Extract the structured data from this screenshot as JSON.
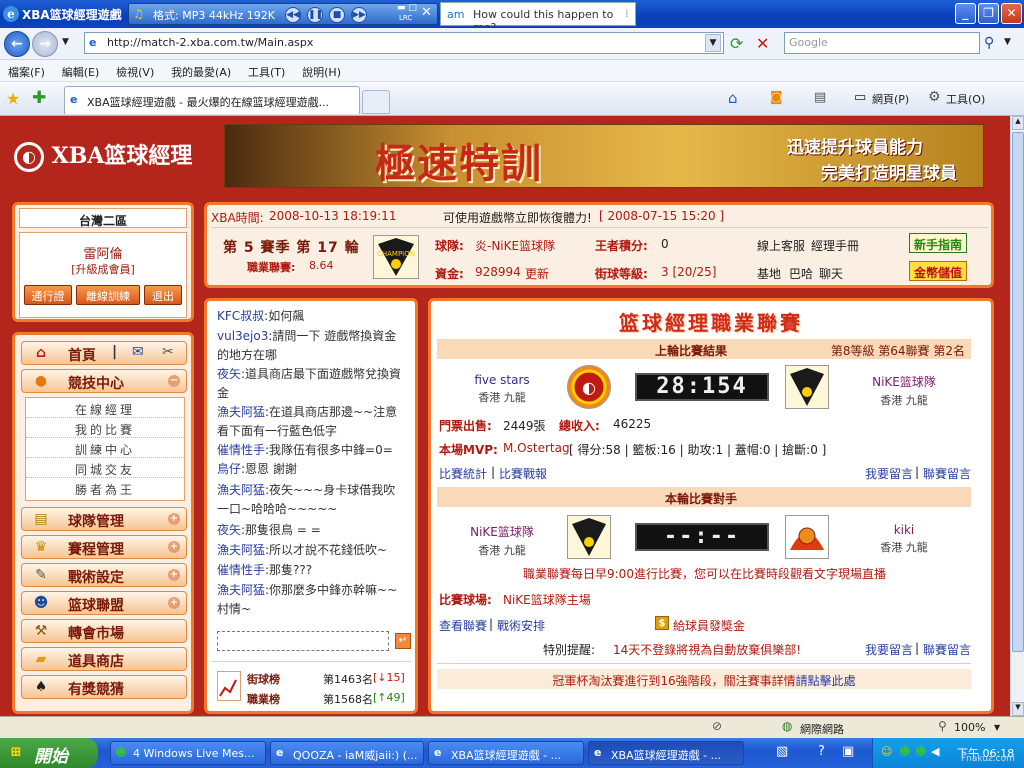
{
  "window": {
    "title": "XBA篮球經理遊戲",
    "media_format": "格式: MP3 44kHz 192K",
    "media_tag": "LRC",
    "tooltip_app": "am",
    "tooltip_song": "How could this happen to me?"
  },
  "browser": {
    "url": "http://match-2.xba.com.tw/Main.aspx",
    "search_placeholder": "Google",
    "menu": [
      "檔案(F)",
      "編輯(E)",
      "檢視(V)",
      "我的最愛(A)",
      "工具(T)",
      "說明(H)"
    ],
    "tab_title": "XBA篮球經理遊戲 - 最火爆的在線篮球經理遊戲...",
    "toolbar_page": "網頁(P)",
    "toolbar_tools": "工具(O)"
  },
  "site": {
    "logo": "XBA篮球經理",
    "banner_main": "極速特訓",
    "banner_line1": "迅速提升球員能力",
    "banner_line2": "完美打造明星球員"
  },
  "user": {
    "region": "台灣二區",
    "name": "雷阿倫",
    "grade": "[升級成會員]",
    "buttons": [
      "通行證",
      "離線訓練",
      "退出"
    ]
  },
  "menu": {
    "home": "首頁",
    "competition": "競技中心",
    "sub": [
      "在線經理",
      "我的比賽",
      "訓練中心",
      "同城交友",
      "勝者為王"
    ],
    "items": [
      "球隊管理",
      "賽程管理",
      "戰術設定",
      "篮球聯盟",
      "轉會市場",
      "道具商店",
      "有獎競猜"
    ]
  },
  "info": {
    "time_label": "XBA時間:",
    "time": "2008-10-13 18:19:11",
    "notice": "可使用遊戲幣立即恢復體力!",
    "notice_date": "[ 2008-07-15 15:20 ]",
    "season": "第 5 賽季 第 17 輪",
    "pro_label": "職業聯賽:",
    "pro_value": "8.64",
    "team_label": "球隊:",
    "team": "炎-NiKE篮球隊",
    "king_label": "王者積分:",
    "king": "0",
    "service": "線上客服",
    "manual": "經理手冊",
    "money_label": "資金:",
    "money": "928994",
    "update": "更新",
    "street_label": "街球等級:",
    "street": "3 [20/25]",
    "base": "基地",
    "baha": "巴哈",
    "chat_link": "聊天",
    "guide_btn": "新手指南",
    "coin_btn": "金幣儲值"
  },
  "chat": {
    "lines": [
      {
        "name": "KFC叔叔",
        "msg": ":如何飆"
      },
      {
        "name": "vul3ejo3",
        "msg": ":請問一下 遊戲幣換資金的地方在哪"
      },
      {
        "name": "夜矢",
        "msg": ":道具商店最下面遊戲幣兌換資金"
      },
      {
        "name": "漁夫阿猛",
        "msg": ":在道具商店那邊~~注意看下面有一行藍色低字"
      },
      {
        "name": "催情性手",
        "msg": ":我隊伍有很多中鋒=0="
      },
      {
        "name": "鳥仔",
        "msg": ":恩恩 謝謝"
      },
      {
        "name": "漁夫阿猛",
        "msg": ":夜矢~~~身卡球借我吹一口~哈哈哈~~~~~"
      },
      {
        "name": "夜矢",
        "msg": ":那隻很鳥 = ="
      },
      {
        "name": "漁夫阿猛",
        "msg": ":所以才說不花錢低吹~"
      },
      {
        "name": "催情性手",
        "msg": ":那隻???"
      },
      {
        "name": "漁夫阿猛",
        "msg": ":你那麼多中鋒亦幹嘛~~村情~"
      }
    ],
    "send": "↵"
  },
  "ranks": [
    {
      "label": "街球榜",
      "value": "第1463名",
      "change": "[↓15]"
    },
    {
      "label": "職業榜",
      "value": "第1568名",
      "change": "[↑49]"
    }
  ],
  "league": {
    "title": "篮球經理職業聯賽",
    "last_title": "上輪比賽結果",
    "last_meta": "第8等級 第64聯賽 第2名",
    "home": {
      "name": "five stars",
      "loc": "香港 九龍"
    },
    "away": {
      "name": "NiKE篮球隊",
      "loc": "香港 九龍"
    },
    "score": "28:154",
    "ticket_label": "門票出售:",
    "ticket": "2449張",
    "income_label": "總收入:",
    "income": "46225",
    "mvp_label": "本場MVP:",
    "mvp": "M.Ostertag",
    "mvp_stats": "[ 得分:58 | 籃板:16 | 助攻:1 | 蓋帽:0 | 搶斷:0 ]",
    "links1": [
      "比賽統計",
      "比賽戰報"
    ],
    "links2": [
      "我要留言",
      "聯賽留言"
    ],
    "next_title": "本輪比賽對手",
    "next_home": {
      "name": "NiKE篮球隊",
      "loc": "香港 九龍"
    },
    "next_away": {
      "name": "kiki",
      "loc": "香港 九龍"
    },
    "next_score": "--:--",
    "schedule_note": "職業聯賽每日早9:00進行比賽，您可以在比賽時段觀看文字現場直播",
    "arena_label": "比賽球場:",
    "arena": "NiKE篮球隊主場",
    "links3": [
      "查看聯賽",
      "戰術安排"
    ],
    "bonus": "給球員發獎金",
    "warning_label": "特別提醒:",
    "warning": "14天不登錄將視為自動放棄俱樂部!",
    "links4": [
      "我要留言",
      "聯賽留言"
    ],
    "cup_note": "冠軍杯淘汰賽進行到16強階段，關注賽事詳情",
    "cup_link": "請點擊此處"
  },
  "status": {
    "zone": "網際網路",
    "zoom": "100%"
  },
  "taskbar": {
    "start": "開始",
    "tasks": [
      "4 Windows Live Mes...",
      "QOOZA - iaM威jaii:) (...",
      "XBA篮球經理遊戲 - ...",
      "XBA篮球經理遊戲 - ..."
    ],
    "clock": "下午 06:18",
    "watermark": "Fnakuz.com"
  },
  "colors": {
    "accent": "#b4251c",
    "panel_border": "#f07a2a",
    "link": "#2a3ea0"
  }
}
